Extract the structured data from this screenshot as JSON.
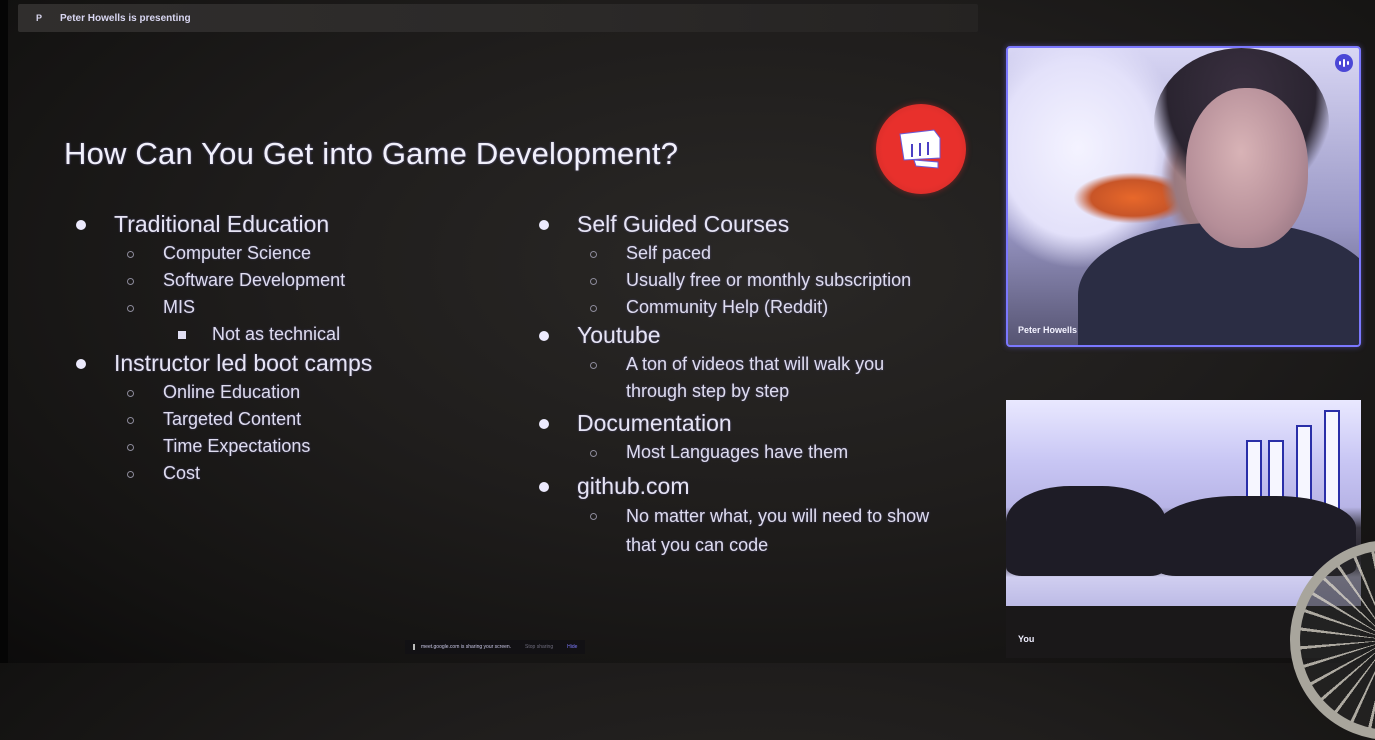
{
  "meeting": {
    "presenter_avatar_initial": "P",
    "presenter_banner": "Peter Howells is presenting"
  },
  "slide": {
    "title": "How Can You Get into Game Development?",
    "logo_icon": "fist-logo-icon",
    "left_column": [
      {
        "label": "Traditional Education",
        "children": [
          {
            "label": "Computer Science"
          },
          {
            "label": "Software Development"
          },
          {
            "label": "MIS",
            "children": [
              {
                "label": "Not as technical"
              }
            ]
          }
        ]
      },
      {
        "label": "Instructor led boot camps",
        "children": [
          {
            "label": "Online Education"
          },
          {
            "label": "Targeted Content"
          },
          {
            "label": "Time Expectations"
          },
          {
            "label": "Cost"
          }
        ]
      }
    ],
    "right_column": [
      {
        "label": "Self Guided Courses",
        "children": [
          {
            "label": "Self paced"
          },
          {
            "label": "Usually free or monthly subscription"
          },
          {
            "label": "Community Help (Reddit)"
          }
        ]
      },
      {
        "label": "Youtube",
        "children": [
          {
            "label": "A ton of videos that will walk you through step by step"
          }
        ]
      },
      {
        "label": "Documentation",
        "children": [
          {
            "label": "Most Languages have them"
          }
        ]
      },
      {
        "label": "github.com",
        "children": [
          {
            "label": "No matter what, you will need to show that you can code"
          }
        ]
      }
    ]
  },
  "tiles": {
    "presenter": {
      "name": "Peter Howells",
      "status_icon": "speaking-indicator-icon"
    },
    "self": {
      "name": "You"
    }
  },
  "share_bar": {
    "message": "meet.google.com is sharing your screen.",
    "stop_label": "Stop sharing",
    "hide_label": "Hide"
  },
  "colors": {
    "accent": "#7b78ff",
    "logo_red": "#e8302c"
  }
}
